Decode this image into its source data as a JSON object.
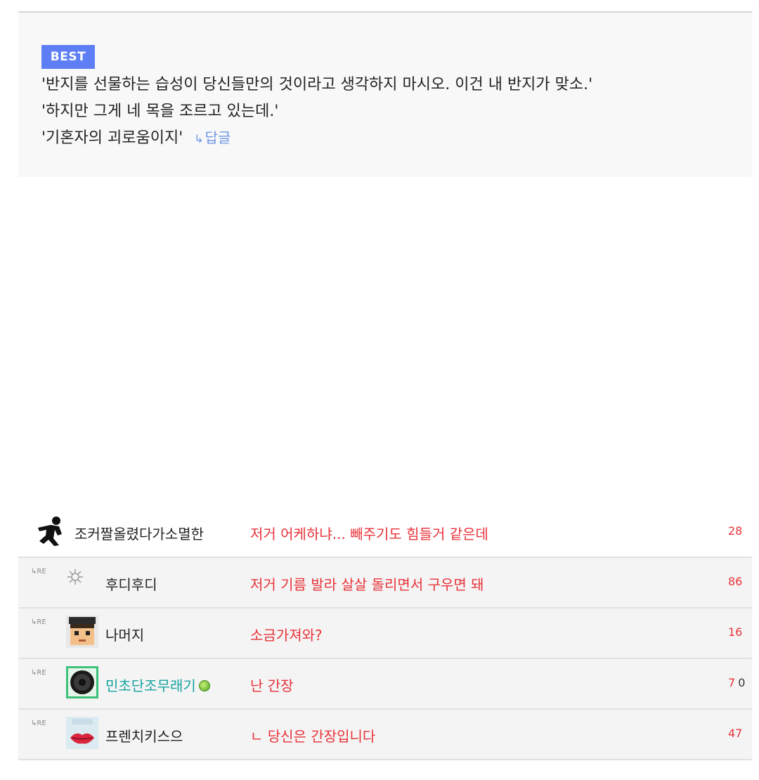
{
  "best": {
    "badge": "BEST",
    "lines": [
      "'반지를 선물하는 습성이 당신들만의 것이라고 생각하지 마시오. 이건 내 반지가 맞소.'",
      "'하지만 그게 네 목을 조르고 있는데.'",
      "'기혼자의 괴로움이지'"
    ],
    "reply_arrow": "↳",
    "reply_label": "답글"
  },
  "comments": [
    {
      "is_reply": false,
      "re_label": "",
      "avatar": "running-figure-icon",
      "nickname": "조커짤올렸다가소멸한",
      "text": "저거 어케하냐... 빼주기도 힘들거 같은데",
      "count": "28",
      "count_extra": ""
    },
    {
      "is_reply": true,
      "re_label": "↳RE",
      "avatar": "gear-flower-icon",
      "nickname": "후디후디",
      "text": "저거 기름 발라 살살 돌리면서 구우면 돼",
      "count": "86",
      "count_extra": ""
    },
    {
      "is_reply": true,
      "re_label": "↳RE",
      "avatar": "pixel-face-avatar",
      "nickname": "나머지",
      "text": "소금가져와?",
      "count": "16",
      "count_extra": ""
    },
    {
      "is_reply": true,
      "re_label": "↳RE",
      "avatar": "dark-circle-avatar",
      "nickname": "민초단조무래기",
      "text": "난 간장",
      "count": "7",
      "count_extra": "0",
      "online": true
    },
    {
      "is_reply": true,
      "re_label": "↳RE",
      "avatar": "lips-avatar",
      "nickname": "프렌치키스으",
      "text": "ㄴ 당신은 간장입니다",
      "count": "47",
      "count_extra": ""
    }
  ],
  "colors": {
    "badge": "#5e7ef5",
    "comment_text": "#e8333a",
    "reply_link": "#6e96e6",
    "teal_nick": "#15a3a0"
  }
}
